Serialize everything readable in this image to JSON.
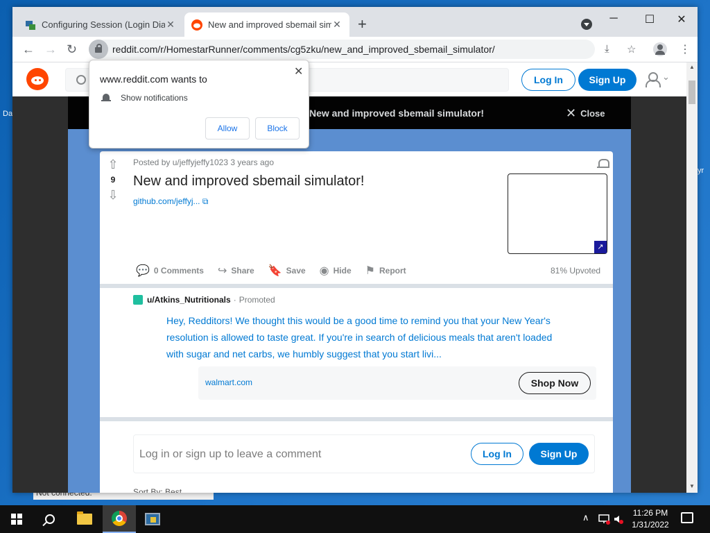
{
  "desktop": {
    "frag_da": "Da",
    "frag_yr": "yr",
    "status_text": "Not connected."
  },
  "browser": {
    "tabs": [
      {
        "title": "Configuring Session (Login Dialog",
        "close": "✕"
      },
      {
        "title": "New and improved sbemail simulator",
        "close": "✕"
      }
    ],
    "new_tab": "+",
    "window_controls": {
      "minimize": "─",
      "maximize": "☐",
      "close": "✕"
    },
    "nav": {
      "back": "←",
      "forward": "→",
      "reload": "↻"
    },
    "url": "reddit.com/r/HomestarRunner/comments/cg5zku/new_and_improved_sbemail_simulator/",
    "toolbar_icons": {
      "install": "⤓",
      "bookmark": "☆",
      "menu": "⋮"
    }
  },
  "reddit": {
    "header": {
      "login": "Log In",
      "signup": "Sign Up",
      "user_menu_chevron": "⌄"
    },
    "modal": {
      "title": "New and improved sbemail simulator!",
      "close_x": "✕",
      "close_label": "Close"
    },
    "post": {
      "upvote": "⇧",
      "downvote": "⇩",
      "vote_count": "9",
      "meta": "Posted by u/jeffyjeffy1023 3 years ago",
      "title": "New and improved sbemail simulator!",
      "link": "github.com/jeffyj...",
      "link_icon": "⧉",
      "thumb_icon": "↗",
      "actions": [
        {
          "icon": "💬",
          "label": "0 Comments"
        },
        {
          "icon": "↪",
          "label": "Share"
        },
        {
          "icon": "🔖",
          "label": "Save"
        },
        {
          "icon": "◉",
          "label": "Hide"
        },
        {
          "icon": "⚑",
          "label": "Report"
        }
      ],
      "upvoted": "81% Upvoted"
    },
    "ad": {
      "user": "u/Atkins_Nutritionals",
      "separator": "·",
      "promoted": "Promoted",
      "text": "Hey, Redditors! We thought this would be a good time to remind you that your New Year's resolution is allowed to taste great. If you're in search of delicious meals that aren't loaded with sugar and net carbs, we humbly suggest that you start livi...",
      "domain": "walmart.com",
      "cta": "Shop Now"
    },
    "comment": {
      "prompt": "Log in or sign up to leave a comment",
      "login": "Log In",
      "signup": "Sign Up"
    },
    "sort_by": "Sort By: Best"
  },
  "popup": {
    "title": "www.reddit.com wants to",
    "permission": "Show notifications",
    "allow": "Allow",
    "block": "Block",
    "close": "✕"
  },
  "taskbar": {
    "tray_chevron": "∧",
    "time": "11:26 PM",
    "date": "1/31/2022"
  }
}
